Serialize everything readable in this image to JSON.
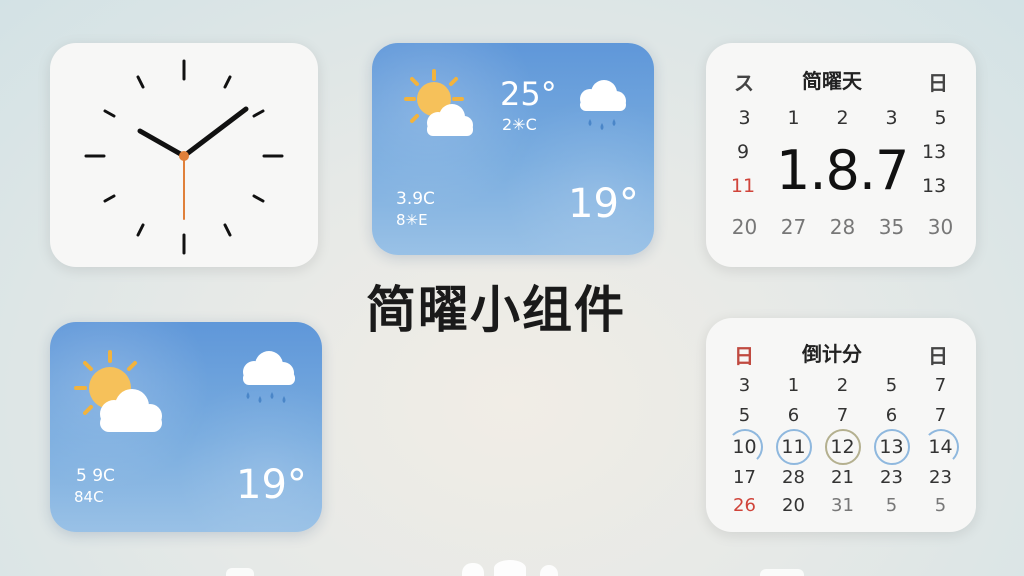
{
  "page_title": "简曜小组件",
  "clock": {
    "hours": 10,
    "minutes": 10,
    "seconds": 30
  },
  "weather_top": {
    "temp": "25°",
    "temp_sub": "2✳C",
    "left_line1": "3.9C",
    "left_line2": "8✳E",
    "big_temp": "19°"
  },
  "weather_bottom": {
    "left_line1": "5 9C",
    "left_line2": "84C",
    "big_temp": "19°"
  },
  "calendar": {
    "left_mark": "ス",
    "title": "简曜天",
    "right_mark": "日",
    "row1": [
      "3",
      "1",
      "2",
      "3",
      "5"
    ],
    "row2_left": "9",
    "row3_left": "11",
    "big_date": "1.8.7",
    "row2_right": "13",
    "row3_right": "13",
    "row4": [
      "20",
      "27",
      "28",
      "35",
      "30"
    ]
  },
  "countdown": {
    "left_mark": "日",
    "title": "倒计分",
    "right_mark": "日",
    "rows": [
      [
        "3",
        "1",
        "2",
        "5",
        "7"
      ],
      [
        "5",
        "6",
        "7",
        "6",
        "7"
      ],
      [
        "10",
        "11",
        "12",
        "13",
        "14"
      ],
      [
        "17",
        "28",
        "21",
        "23",
        "23"
      ],
      [
        "26",
        "20",
        "31",
        "5",
        "5"
      ]
    ]
  },
  "colors": {
    "accent_blue": "#6fa4dc",
    "highlight_red": "#d0443a",
    "clock_orange": "#e0803a"
  }
}
